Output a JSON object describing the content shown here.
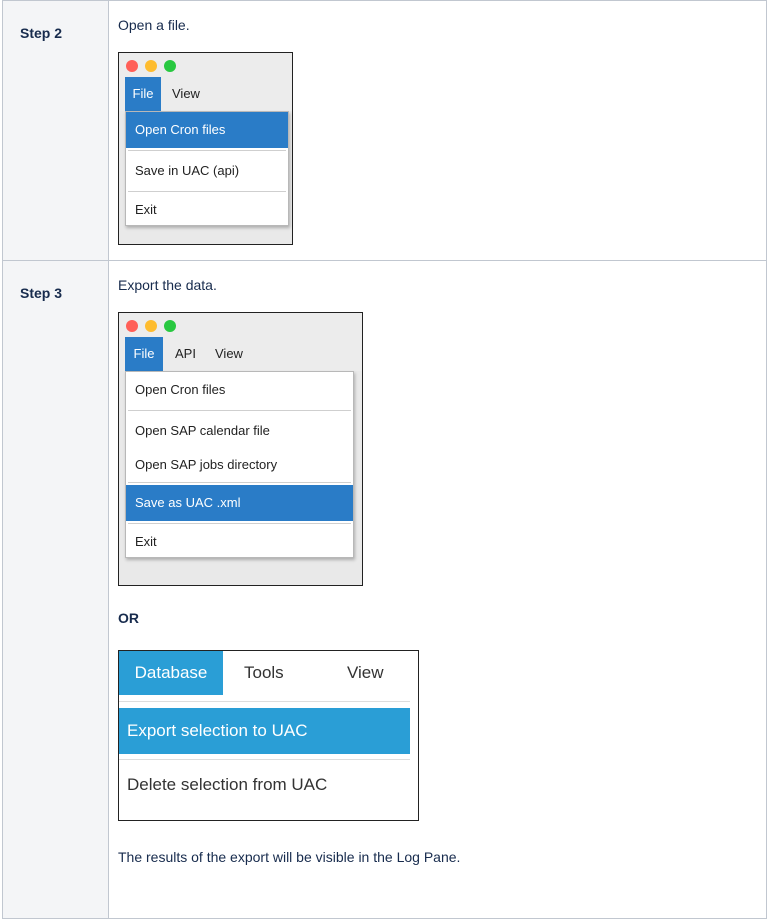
{
  "steps": [
    {
      "label": "Step 2",
      "description": "Open a file.",
      "window": {
        "menu": [
          "File",
          "View"
        ],
        "items": [
          "Open Cron files",
          "Save in UAC (api)",
          "Exit"
        ]
      }
    },
    {
      "label": "Step 3",
      "description": "Export the data.",
      "window": {
        "menu": [
          "File",
          "API",
          "View"
        ],
        "items": [
          "Open Cron files",
          "Open SAP calendar file",
          "Open SAP jobs directory",
          "Save as UAC .xml",
          "Exit"
        ]
      },
      "or_label": "OR",
      "db_window": {
        "menu": [
          "Database",
          "Tools",
          "View"
        ],
        "items": [
          "Export selection to UAC",
          "Delete selection from UAC"
        ]
      },
      "results": "The results of the export will be visible in the Log Pane."
    }
  ],
  "colors": {
    "mac_selection": "#2a7cc7",
    "db_selection": "#2a9ed6",
    "close_dot": "#ff5f57",
    "minimize_dot": "#febc2e",
    "zoom_dot": "#28c840"
  },
  "icons": [
    "close-dot-icon",
    "minimize-dot-icon",
    "zoom-dot-icon"
  ]
}
